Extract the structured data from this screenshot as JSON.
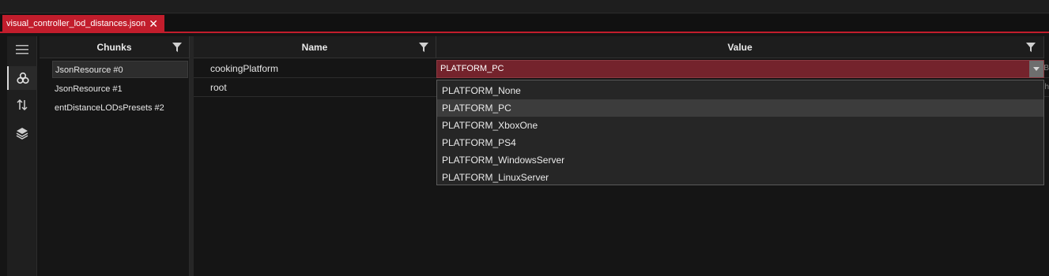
{
  "tab": {
    "title": "visual_controller_lod_distances.json",
    "close_glyph": "✕"
  },
  "toolstrip": {
    "items": [
      "menu-icon",
      "chunks-icon",
      "sort-icon",
      "layers-icon"
    ]
  },
  "chunks": {
    "header": "Chunks",
    "items": [
      {
        "label": "JsonResource #0"
      },
      {
        "label": "JsonResource #1"
      },
      {
        "label": "entDistanceLODsPresets #2"
      }
    ]
  },
  "grid": {
    "columns": {
      "name": "Name",
      "value": "Value"
    },
    "rows": [
      {
        "name": "cookingPlatform",
        "value": "PLATFORM_PC",
        "extra": "B"
      },
      {
        "name": "root",
        "value": "",
        "extra": "h"
      }
    ]
  },
  "dropdown": {
    "selected": "PLATFORM_PC",
    "options": [
      "PLATFORM_None",
      "PLATFORM_PC",
      "PLATFORM_XboxOne",
      "PLATFORM_PS4",
      "PLATFORM_WindowsServer",
      "PLATFORM_LinuxServer"
    ]
  },
  "colors": {
    "accent": "#c21d2c",
    "editing_cell": "#74232c",
    "background": "#151515"
  }
}
